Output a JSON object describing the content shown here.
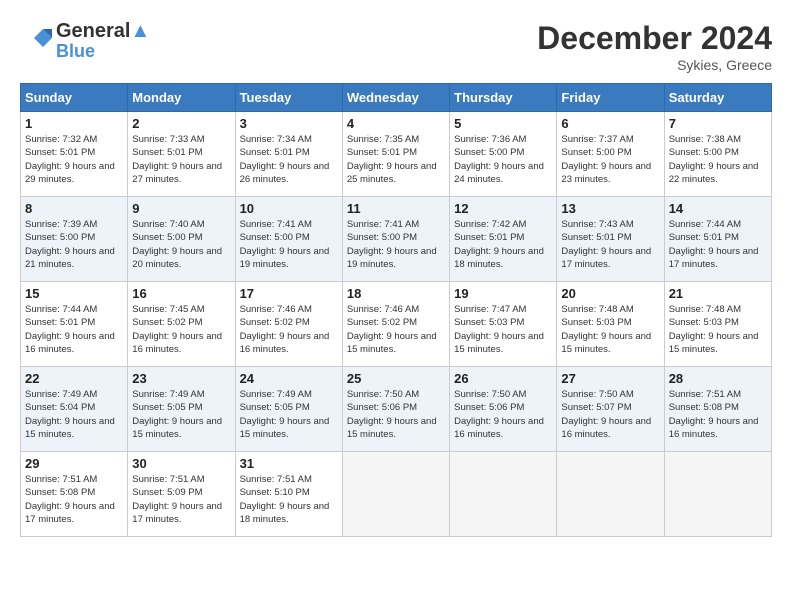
{
  "header": {
    "logo_line1": "General",
    "logo_line2": "Blue",
    "month_year": "December 2024",
    "location": "Sykies, Greece"
  },
  "days_of_week": [
    "Sunday",
    "Monday",
    "Tuesday",
    "Wednesday",
    "Thursday",
    "Friday",
    "Saturday"
  ],
  "weeks": [
    [
      {
        "day": 1,
        "sunrise": "7:32 AM",
        "sunset": "5:01 PM",
        "daylight_h": 9,
        "daylight_m": 29
      },
      {
        "day": 2,
        "sunrise": "7:33 AM",
        "sunset": "5:01 PM",
        "daylight_h": 9,
        "daylight_m": 27
      },
      {
        "day": 3,
        "sunrise": "7:34 AM",
        "sunset": "5:01 PM",
        "daylight_h": 9,
        "daylight_m": 26
      },
      {
        "day": 4,
        "sunrise": "7:35 AM",
        "sunset": "5:01 PM",
        "daylight_h": 9,
        "daylight_m": 25
      },
      {
        "day": 5,
        "sunrise": "7:36 AM",
        "sunset": "5:00 PM",
        "daylight_h": 9,
        "daylight_m": 24
      },
      {
        "day": 6,
        "sunrise": "7:37 AM",
        "sunset": "5:00 PM",
        "daylight_h": 9,
        "daylight_m": 23
      },
      {
        "day": 7,
        "sunrise": "7:38 AM",
        "sunset": "5:00 PM",
        "daylight_h": 9,
        "daylight_m": 22
      }
    ],
    [
      {
        "day": 8,
        "sunrise": "7:39 AM",
        "sunset": "5:00 PM",
        "daylight_h": 9,
        "daylight_m": 21
      },
      {
        "day": 9,
        "sunrise": "7:40 AM",
        "sunset": "5:00 PM",
        "daylight_h": 9,
        "daylight_m": 20
      },
      {
        "day": 10,
        "sunrise": "7:41 AM",
        "sunset": "5:00 PM",
        "daylight_h": 9,
        "daylight_m": 19
      },
      {
        "day": 11,
        "sunrise": "7:41 AM",
        "sunset": "5:00 PM",
        "daylight_h": 9,
        "daylight_m": 19
      },
      {
        "day": 12,
        "sunrise": "7:42 AM",
        "sunset": "5:01 PM",
        "daylight_h": 9,
        "daylight_m": 18
      },
      {
        "day": 13,
        "sunrise": "7:43 AM",
        "sunset": "5:01 PM",
        "daylight_h": 9,
        "daylight_m": 17
      },
      {
        "day": 14,
        "sunrise": "7:44 AM",
        "sunset": "5:01 PM",
        "daylight_h": 9,
        "daylight_m": 17
      }
    ],
    [
      {
        "day": 15,
        "sunrise": "7:44 AM",
        "sunset": "5:01 PM",
        "daylight_h": 9,
        "daylight_m": 16
      },
      {
        "day": 16,
        "sunrise": "7:45 AM",
        "sunset": "5:02 PM",
        "daylight_h": 9,
        "daylight_m": 16
      },
      {
        "day": 17,
        "sunrise": "7:46 AM",
        "sunset": "5:02 PM",
        "daylight_h": 9,
        "daylight_m": 16
      },
      {
        "day": 18,
        "sunrise": "7:46 AM",
        "sunset": "5:02 PM",
        "daylight_h": 9,
        "daylight_m": 15
      },
      {
        "day": 19,
        "sunrise": "7:47 AM",
        "sunset": "5:03 PM",
        "daylight_h": 9,
        "daylight_m": 15
      },
      {
        "day": 20,
        "sunrise": "7:48 AM",
        "sunset": "5:03 PM",
        "daylight_h": 9,
        "daylight_m": 15
      },
      {
        "day": 21,
        "sunrise": "7:48 AM",
        "sunset": "5:03 PM",
        "daylight_h": 9,
        "daylight_m": 15
      }
    ],
    [
      {
        "day": 22,
        "sunrise": "7:49 AM",
        "sunset": "5:04 PM",
        "daylight_h": 9,
        "daylight_m": 15
      },
      {
        "day": 23,
        "sunrise": "7:49 AM",
        "sunset": "5:05 PM",
        "daylight_h": 9,
        "daylight_m": 15
      },
      {
        "day": 24,
        "sunrise": "7:49 AM",
        "sunset": "5:05 PM",
        "daylight_h": 9,
        "daylight_m": 15
      },
      {
        "day": 25,
        "sunrise": "7:50 AM",
        "sunset": "5:06 PM",
        "daylight_h": 9,
        "daylight_m": 15
      },
      {
        "day": 26,
        "sunrise": "7:50 AM",
        "sunset": "5:06 PM",
        "daylight_h": 9,
        "daylight_m": 16
      },
      {
        "day": 27,
        "sunrise": "7:50 AM",
        "sunset": "5:07 PM",
        "daylight_h": 9,
        "daylight_m": 16
      },
      {
        "day": 28,
        "sunrise": "7:51 AM",
        "sunset": "5:08 PM",
        "daylight_h": 9,
        "daylight_m": 16
      }
    ],
    [
      {
        "day": 29,
        "sunrise": "7:51 AM",
        "sunset": "5:08 PM",
        "daylight_h": 9,
        "daylight_m": 17
      },
      {
        "day": 30,
        "sunrise": "7:51 AM",
        "sunset": "5:09 PM",
        "daylight_h": 9,
        "daylight_m": 17
      },
      {
        "day": 31,
        "sunrise": "7:51 AM",
        "sunset": "5:10 PM",
        "daylight_h": 9,
        "daylight_m": 18
      },
      null,
      null,
      null,
      null
    ]
  ],
  "labels": {
    "sunrise": "Sunrise:",
    "sunset": "Sunset:",
    "daylight": "Daylight:"
  }
}
